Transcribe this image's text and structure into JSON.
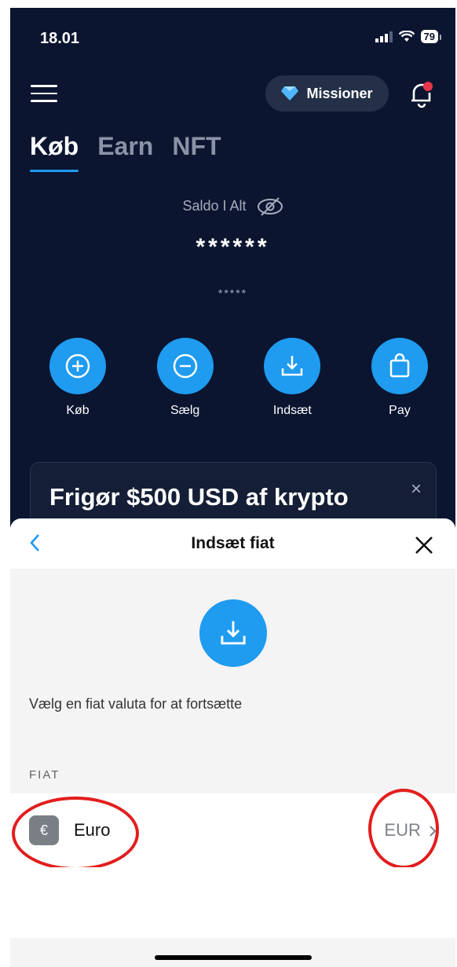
{
  "status": {
    "time": "18.01",
    "battery": "79"
  },
  "header": {
    "missions_label": "Missioner"
  },
  "tabs": [
    {
      "label": "Køb",
      "active": true
    },
    {
      "label": "Earn",
      "active": false
    },
    {
      "label": "NFT",
      "active": false
    }
  ],
  "balance": {
    "label": "Saldo I Alt",
    "value": "******",
    "sub": "*****"
  },
  "actions": [
    {
      "label": "Køb",
      "icon": "plus-circle-icon"
    },
    {
      "label": "Sælg",
      "icon": "minus-circle-icon"
    },
    {
      "label": "Indsæt",
      "icon": "download-icon"
    },
    {
      "label": "Pay",
      "icon": "shopping-bag-icon"
    }
  ],
  "promo": {
    "title": "Frigør $500 USD af krypto",
    "close": "×"
  },
  "sheet": {
    "title": "Indsæt fiat",
    "instruction": "Vælg en fiat valuta for at fortsætte",
    "section_label": "FIAT",
    "currency": {
      "symbol": "€",
      "name": "Euro",
      "code": "EUR"
    }
  },
  "colors": {
    "background": "#0b1530",
    "accent": "#1f9bf0",
    "highlight": "#e21d1d"
  }
}
